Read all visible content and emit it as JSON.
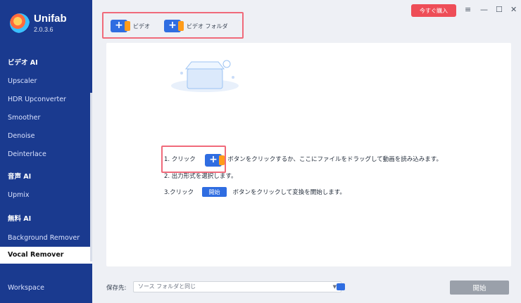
{
  "app": {
    "name": "Unifab",
    "version": "2.0.3.6"
  },
  "sidebar": {
    "sections": [
      {
        "title": "ビデオ AI",
        "items": [
          "Upscaler",
          "HDR Upconverter",
          "Smoother",
          "Denoise",
          "Deinterlace"
        ]
      },
      {
        "title": "音声 AI",
        "items": [
          "Upmix"
        ]
      },
      {
        "title": "無料 AI",
        "items": [
          "Background Remover",
          "Vocal Remover"
        ]
      }
    ],
    "active_item": "Vocal Remover",
    "footer_item": "Workspace"
  },
  "top": {
    "buy_button": "今すぐ購入",
    "add_video": "ビデオ",
    "add_folder": "ビデオ フォルダ"
  },
  "guide": {
    "step1_prefix": "1. クリック",
    "step1_suffix": "ボタンをクリックするか、ここにファイルをドラッグして動画を読み込みます。",
    "step2": "2. 出力形式を選択します。",
    "step3_prefix": "3.クリック",
    "step3_button": "開始",
    "step3_suffix": "ボタンをクリックして変換を開始します。"
  },
  "bottom": {
    "save_label": "保存先:",
    "save_value": "ソース フォルダと同じ",
    "start_button": "開始"
  }
}
